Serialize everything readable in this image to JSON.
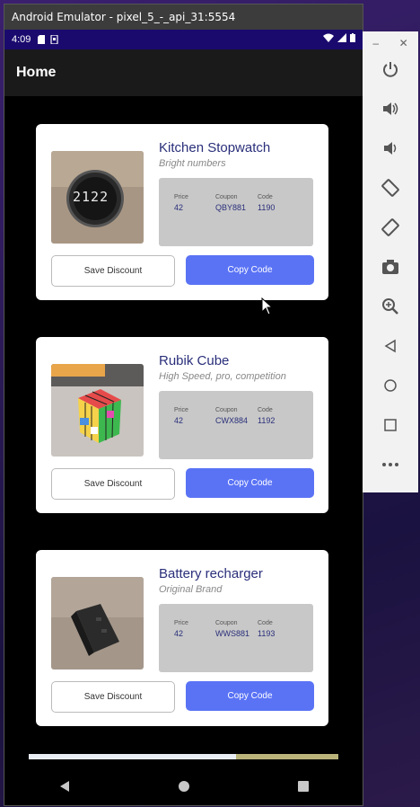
{
  "window": {
    "title": "Android Emulator - pixel_5_-_api_31:5554"
  },
  "status_bar": {
    "time": "4:09"
  },
  "app_bar": {
    "title": "Home"
  },
  "products": [
    {
      "title": "Kitchen Stopwatch",
      "subtitle": "Bright numbers",
      "price_label": "Price",
      "price": "42",
      "coupon_label": "Coupon",
      "coupon": "QBY881",
      "code_label": "Code",
      "code": "1190",
      "save_label": "Save Discount",
      "copy_label": "Copy Code",
      "thumb_icon": "stopwatch-image",
      "thumb_text": "2122"
    },
    {
      "title": "Rubik Cube",
      "subtitle": "High Speed, pro, competition",
      "price_label": "Price",
      "price": "42",
      "coupon_label": "Coupon",
      "coupon": "CWX884",
      "code_label": "Code",
      "code": "1192",
      "save_label": "Save Discount",
      "copy_label": "Copy Code",
      "thumb_icon": "rubik-cube-image"
    },
    {
      "title": "Battery recharger",
      "subtitle": "Original Brand",
      "price_label": "Price",
      "price": "42",
      "coupon_label": "Coupon",
      "coupon": "WWS881",
      "code_label": "Code",
      "code": "1193",
      "save_label": "Save Discount",
      "copy_label": "Copy Code",
      "thumb_icon": "battery-charger-image"
    }
  ],
  "scroll_progress": 0.67,
  "colors": {
    "accent": "#5a73f5",
    "title_text": "#2a2f7a",
    "status_bar": "#1a0a6e",
    "info_panel": "#c8c8c8"
  },
  "side_panel": {
    "tools": [
      "power-icon",
      "volume-up-icon",
      "volume-down-icon",
      "rotate-left-icon",
      "rotate-right-icon",
      "camera-icon",
      "zoom-icon",
      "back-icon",
      "home-icon",
      "overview-icon",
      "more-icon"
    ]
  }
}
